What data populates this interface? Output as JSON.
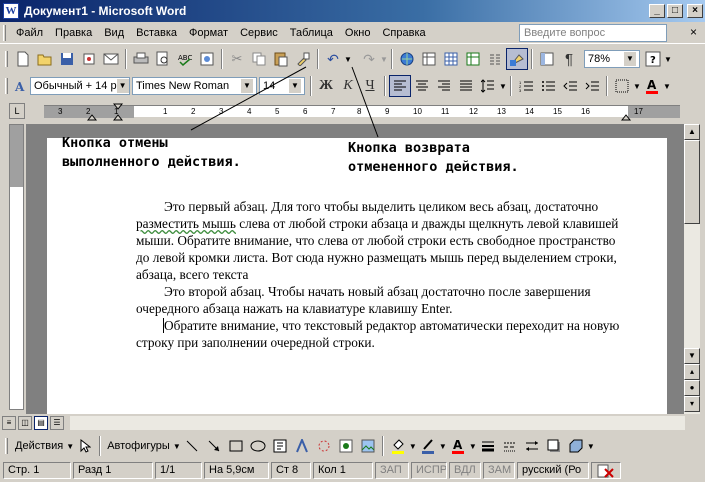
{
  "window": {
    "title": "Документ1 - Microsoft Word",
    "icon": "W",
    "minimize": "_",
    "maximize": "□",
    "close": "×"
  },
  "menu": {
    "items": [
      "Файл",
      "Правка",
      "Вид",
      "Вставка",
      "Формат",
      "Сервис",
      "Таблица",
      "Окно",
      "Справка"
    ],
    "help_placeholder": "Введите вопрос",
    "close_doc": "×"
  },
  "toolbar": {
    "zoom": "78%"
  },
  "formatting": {
    "style": "Обычный + 14 р",
    "font": "Times New Roman",
    "size": "14",
    "bold": "Ж",
    "italic": "К",
    "underline": "Ч"
  },
  "ruler": {
    "numbers": [
      "3",
      "2",
      "1",
      "1",
      "2",
      "3",
      "4",
      "5",
      "6",
      "7",
      "8",
      "9",
      "10",
      "11",
      "12",
      "13",
      "14",
      "15",
      "16",
      "17"
    ]
  },
  "annotations": {
    "undo_label": "Кнопка отмены\nвыполненного действия.",
    "redo_label": "Кнопка возврата\nотмененного действия."
  },
  "document": {
    "p1_before": "Это первый абзац. Для того чтобы выделить целиком весь абзац, достаточно ",
    "p1_squiggle": "разместить мышь",
    "p1_after": " слева от любой строки абзаца и дважды щелкнуть левой клавишей мыши. Обратите внимание, что слева от любой строки есть свободное пространство до левой кромки листа. Вот сюда нужно размещать мышь перед выделением строки, абзаца, всего текста",
    "p2": "Это второй абзац. Чтобы начать новый абзац достаточно после завершения очередного абзаца нажать на клавиатуре клавишу Enter.",
    "p3": "Обратите внимание, что текстовый редактор автоматически переходит на новую строку при заполнении очередной строки."
  },
  "drawing": {
    "actions": "Действия",
    "autoshapes": "Автофигуры"
  },
  "status": {
    "page": "Стр. 1",
    "section": "Разд 1",
    "pages": "1/1",
    "at": "На 5,9см",
    "line": "Ст 8",
    "col": "Кол 1",
    "rec": "ЗАП",
    "trk": "ИСПР",
    "ext": "ВДЛ",
    "ovr": "ЗАМ",
    "lang": "русский (Ро"
  },
  "colors": {
    "title_from": "#0a246a",
    "title_to": "#a6caf0",
    "chrome": "#d4d0c8",
    "font_color_bar": "#ff0000",
    "highlight_bar": "#ffff00"
  }
}
